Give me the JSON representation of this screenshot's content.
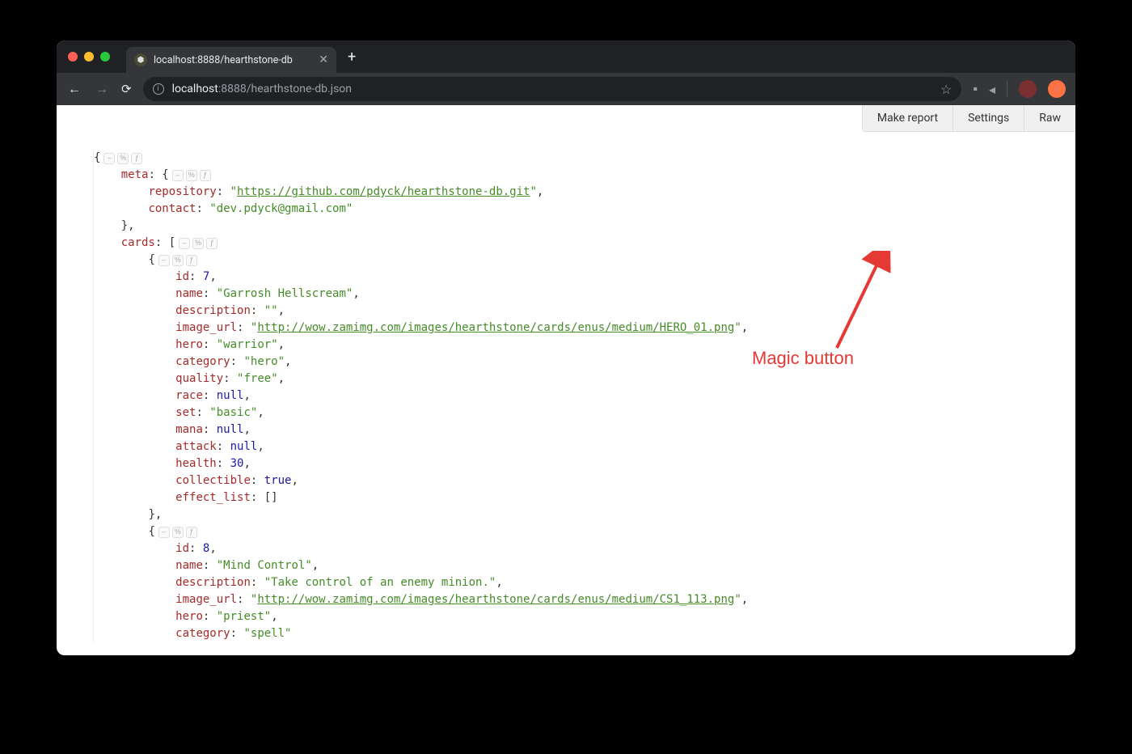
{
  "tab": {
    "title": "localhost:8888/hearthstone-db"
  },
  "url": {
    "host": "localhost",
    "port": ":8888",
    "path": "/hearthstone-db.json"
  },
  "toolbar": {
    "make_report": "Make report",
    "settings": "Settings",
    "raw": "Raw"
  },
  "json": {
    "meta_key": "meta",
    "repository_key": "repository",
    "repository_val": "https://github.com/pdyck/hearthstone-db.git",
    "contact_key": "contact",
    "contact_val": "dev.pdyck@gmail.com",
    "cards_key": "cards",
    "card1": {
      "id_key": "id",
      "id_val": "7",
      "name_key": "name",
      "name_val": "Garrosh Hellscream",
      "desc_key": "description",
      "desc_val": "",
      "img_key": "image_url",
      "img_val": "http://wow.zamimg.com/images/hearthstone/cards/enus/medium/HERO_01.png",
      "hero_key": "hero",
      "hero_val": "warrior",
      "cat_key": "category",
      "cat_val": "hero",
      "qual_key": "quality",
      "qual_val": "free",
      "race_key": "race",
      "race_val": "null",
      "set_key": "set",
      "set_val": "basic",
      "mana_key": "mana",
      "mana_val": "null",
      "atk_key": "attack",
      "atk_val": "null",
      "hp_key": "health",
      "hp_val": "30",
      "coll_key": "collectible",
      "coll_val": "true",
      "eff_key": "effect_list"
    },
    "card2": {
      "id_key": "id",
      "id_val": "8",
      "name_key": "name",
      "name_val": "Mind Control",
      "desc_key": "description",
      "desc_val": "Take control of an enemy minion.",
      "img_key": "image_url",
      "img_val": "http://wow.zamimg.com/images/hearthstone/cards/enus/medium/CS1_113.png",
      "hero_key": "hero",
      "hero_val": "priest",
      "cat_key": "category",
      "cat_val": "spell"
    }
  },
  "annotation": {
    "label": "Magic button"
  },
  "collapse": {
    "minus": "–",
    "pct": "%",
    "fx": "ƒ"
  }
}
